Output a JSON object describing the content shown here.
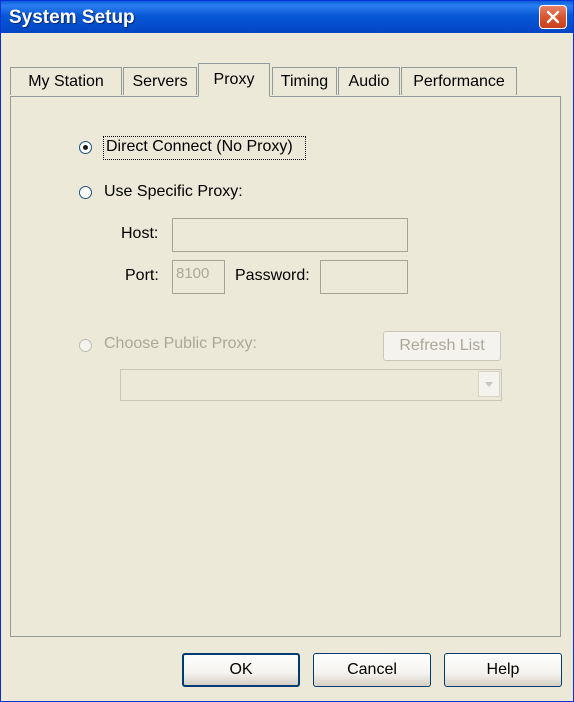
{
  "window": {
    "title": "System Setup"
  },
  "tabs": [
    {
      "label": "My Station"
    },
    {
      "label": "Servers"
    },
    {
      "label": "Proxy"
    },
    {
      "label": "Timing"
    },
    {
      "label": "Audio"
    },
    {
      "label": "Performance"
    }
  ],
  "active_tab": "Proxy",
  "proxy": {
    "direct_label": "Direct Connect (No Proxy)",
    "direct_selected": true,
    "specific_label": "Use Specific Proxy:",
    "host_label": "Host:",
    "host_value": "",
    "port_label": "Port:",
    "port_value": "8100",
    "password_label": "Password:",
    "password_value": "",
    "public_label": "Choose Public Proxy:",
    "refresh_label": "Refresh List",
    "public_selected": ""
  },
  "buttons": {
    "ok": "OK",
    "cancel": "Cancel",
    "help": "Help"
  },
  "colors": {
    "titlebar": "#0858d6",
    "face": "#ece9d8",
    "close": "#d9552e"
  }
}
